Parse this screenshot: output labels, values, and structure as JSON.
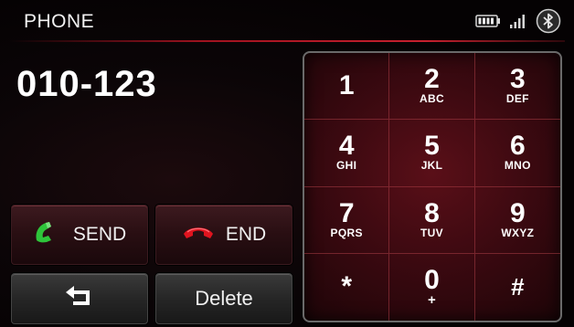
{
  "header": {
    "title": "PHONE"
  },
  "status": {
    "icons": [
      "battery-icon",
      "signal-icon",
      "bluetooth-icon"
    ]
  },
  "display": {
    "number": "010-123"
  },
  "actions": {
    "send_label": "SEND",
    "end_label": "END",
    "delete_label": "Delete",
    "send_color": "#2ec43a",
    "end_color": "#e0141f"
  },
  "keypad": {
    "keys": [
      {
        "digit": "1",
        "letters": ""
      },
      {
        "digit": "2",
        "letters": "ABC"
      },
      {
        "digit": "3",
        "letters": "DEF"
      },
      {
        "digit": "4",
        "letters": "GHI"
      },
      {
        "digit": "5",
        "letters": "JKL"
      },
      {
        "digit": "6",
        "letters": "MNO"
      },
      {
        "digit": "7",
        "letters": "PQRS"
      },
      {
        "digit": "8",
        "letters": "TUV"
      },
      {
        "digit": "9",
        "letters": "WXYZ"
      },
      {
        "digit": "*",
        "letters": ""
      },
      {
        "digit": "0",
        "letters": "+"
      },
      {
        "digit": "#",
        "letters": ""
      }
    ]
  },
  "theme": {
    "accent": "#c8202e"
  }
}
